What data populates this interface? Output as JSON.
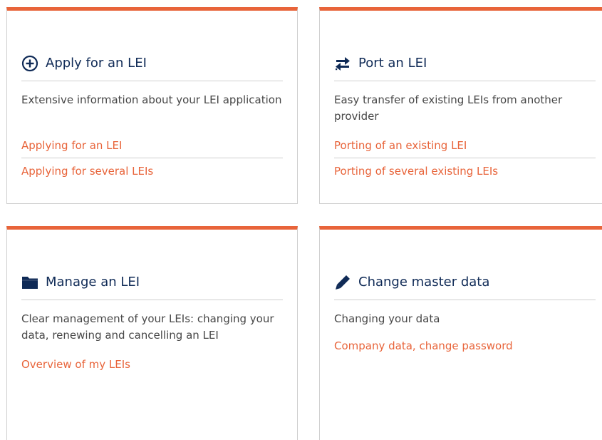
{
  "colors": {
    "accent": "#e8643a",
    "title": "#0f2a56",
    "text": "#474747",
    "border": "#cfcfcf"
  },
  "cards": [
    {
      "title": "Apply for an LEI",
      "icon": "plus-circle-icon",
      "description": "Extensive information about your LEI application",
      "links": [
        "Applying for an LEI",
        "Applying for several LEIs"
      ]
    },
    {
      "title": "Port an LEI",
      "icon": "transfer-arrows-icon",
      "description": "Easy transfer of existing LEIs from another provider",
      "links": [
        "Porting of an existing LEI",
        "Porting of several existing LEIs"
      ]
    },
    {
      "title": "Manage an LEI",
      "icon": "folder-icon",
      "description": "Clear management of your LEIs: changing your data, renewing and cancelling an LEI",
      "links": [
        "Overview of my LEIs"
      ]
    },
    {
      "title": "Change master data",
      "icon": "pencil-icon",
      "description": "Changing your data",
      "links": [
        "Company data, change password"
      ]
    }
  ]
}
